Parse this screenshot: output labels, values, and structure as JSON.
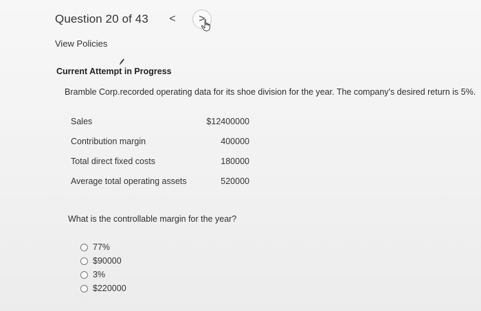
{
  "header": {
    "question_label": "Question 20 of 43",
    "prev_icon": "<",
    "next_icon": ">"
  },
  "view_policies": "View Policies",
  "attempt_status": "Current Attempt in Progress",
  "question": {
    "text": "Bramble Corp.recorded operating data for its shoe division for the year. The company's desired return is 5%.",
    "table": [
      {
        "label": "Sales",
        "value": "$12400000"
      },
      {
        "label": "Contribution margin",
        "value": "400000"
      },
      {
        "label": "Total direct fixed costs",
        "value": "180000"
      },
      {
        "label": "Average total operating assets",
        "value": "520000"
      }
    ],
    "prompt": "What is the controllable margin for the year?",
    "options": [
      "77%",
      "$90000",
      "3%",
      "$220000"
    ]
  }
}
